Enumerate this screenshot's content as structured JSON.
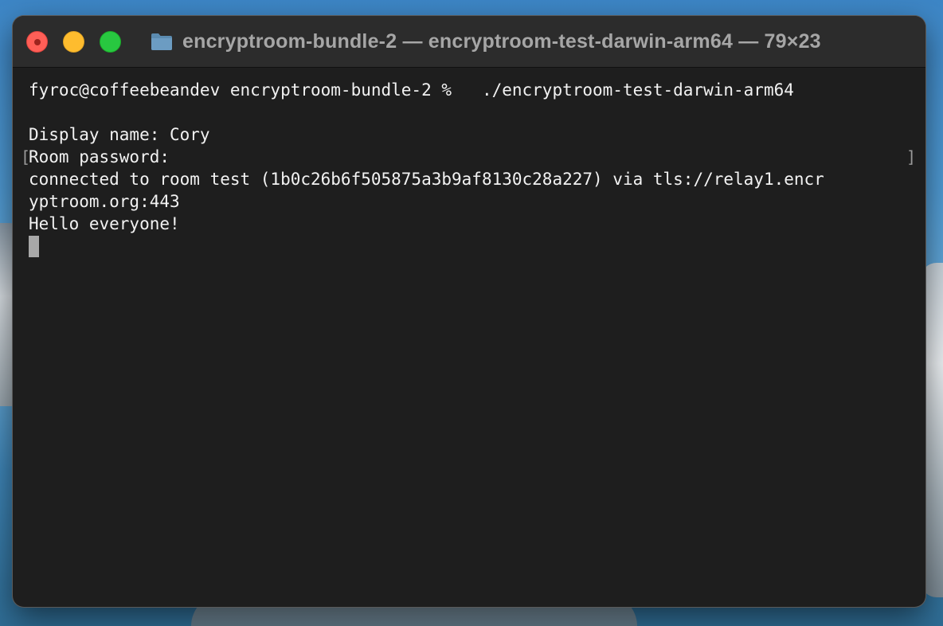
{
  "window": {
    "title": "encryptroom-bundle-2 — encryptroom-test-darwin-arm64 — 79×23",
    "traffic_lights": {
      "close": "#ff5f57",
      "minimize": "#febc2e",
      "zoom": "#28c840"
    },
    "folder_icon": "folder-icon"
  },
  "terminal": {
    "background": "#1e1e1e",
    "foreground": "#f2f2f2",
    "lines": [
      "fyroc@coffeebeandev encryptroom-bundle-2 %   ./encryptroom-test-darwin-arm64",
      "",
      "Display name: Cory",
      "Room password:",
      "connected to room test (1b0c26b6f505875a3b9af8130c28a227) via tls://relay1.encr",
      "yptroom.org:443",
      "Hello everyone!"
    ]
  }
}
